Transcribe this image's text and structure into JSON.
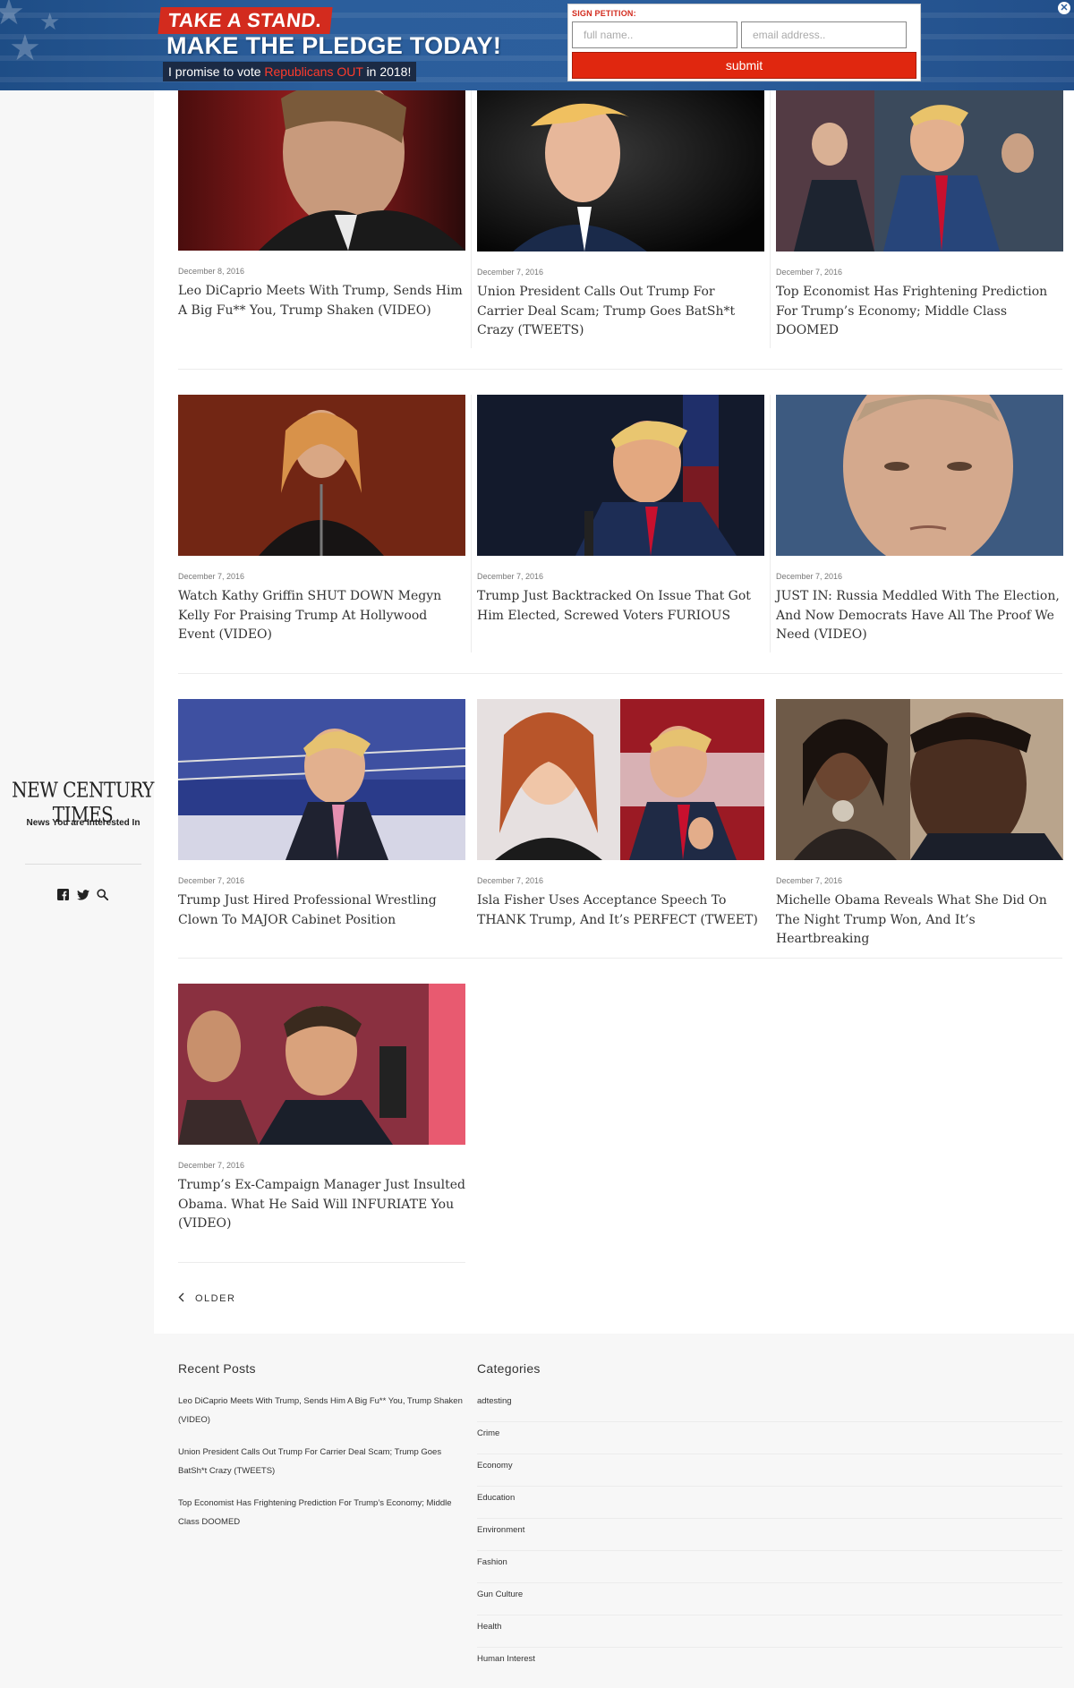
{
  "banner": {
    "line1": "TAKE A STAND.",
    "line2": "MAKE THE PLEDGE TODAY!",
    "line3_pre": "I promise to vote ",
    "line3_highlight": "Republicans OUT",
    "line3_post": " in 2018!",
    "petition_label": "SIGN PETITION:",
    "name_placeholder": "full name..",
    "email_placeholder": "email address..",
    "submit_label": "submit",
    "close_icon": "close-icon"
  },
  "site": {
    "logo": "NEW CENTURY TIMES",
    "tagline": "News You are Interested In",
    "social_icons": [
      "facebook-icon",
      "twitter-icon",
      "search-icon"
    ]
  },
  "posts": [
    {
      "date": "December 8, 2016",
      "title": "Leo DiCaprio Meets With Trump, Sends Him A Big Fu** You, Trump Shaken (VIDEO)"
    },
    {
      "date": "December 7, 2016",
      "title": "Union President Calls Out Trump For Carrier Deal Scam; Trump Goes BatSh*t Crazy (TWEETS)"
    },
    {
      "date": "December 7, 2016",
      "title": "Top Economist Has Frightening Prediction For Trump’s Economy; Middle Class DOOMED"
    },
    {
      "date": "December 7, 2016",
      "title": "Watch Kathy Griffin SHUT DOWN Megyn Kelly For Praising Trump At Hollywood Event (VIDEO)"
    },
    {
      "date": "December 7, 2016",
      "title": "Trump Just Backtracked On Issue That Got Him Elected, Screwed Voters FURIOUS"
    },
    {
      "date": "December 7, 2016",
      "title": "JUST IN: Russia Meddled With The Election, And Now Democrats Have All The Proof We Need (VIDEO)"
    },
    {
      "date": "December 7, 2016",
      "title": "Trump Just Hired Professional Wrestling Clown To MAJOR Cabinet Position"
    },
    {
      "date": "December 7, 2016",
      "title": "Isla Fisher Uses Acceptance Speech To THANK Trump, And It’s PERFECT (TWEET)"
    },
    {
      "date": "December 7, 2016",
      "title": "Michelle Obama Reveals What She Did On The Night Trump Won, And It’s Heartbreaking"
    },
    {
      "date": "December 7, 2016",
      "title": "Trump’s Ex-Campaign Manager Just Insulted Obama. What He Said Will INFURIATE You (VIDEO)"
    }
  ],
  "pagination": {
    "older_label": "OLDER"
  },
  "footer": {
    "recent_posts_title": "Recent Posts",
    "recent_posts": [
      "Leo DiCaprio Meets With Trump, Sends Him A Big Fu** You, Trump Shaken (VIDEO)",
      "Union President Calls Out Trump For Carrier Deal Scam; Trump Goes BatSh*t Crazy (TWEETS)",
      "Top Economist Has Frightening Prediction For Trump’s Economy; Middle Class DOOMED"
    ],
    "categories_title": "Categories",
    "categories": [
      "adtesting",
      "Crime",
      "Economy",
      "Education",
      "Environment",
      "Fashion",
      "Gun Culture",
      "Health",
      "Human Interest"
    ]
  }
}
